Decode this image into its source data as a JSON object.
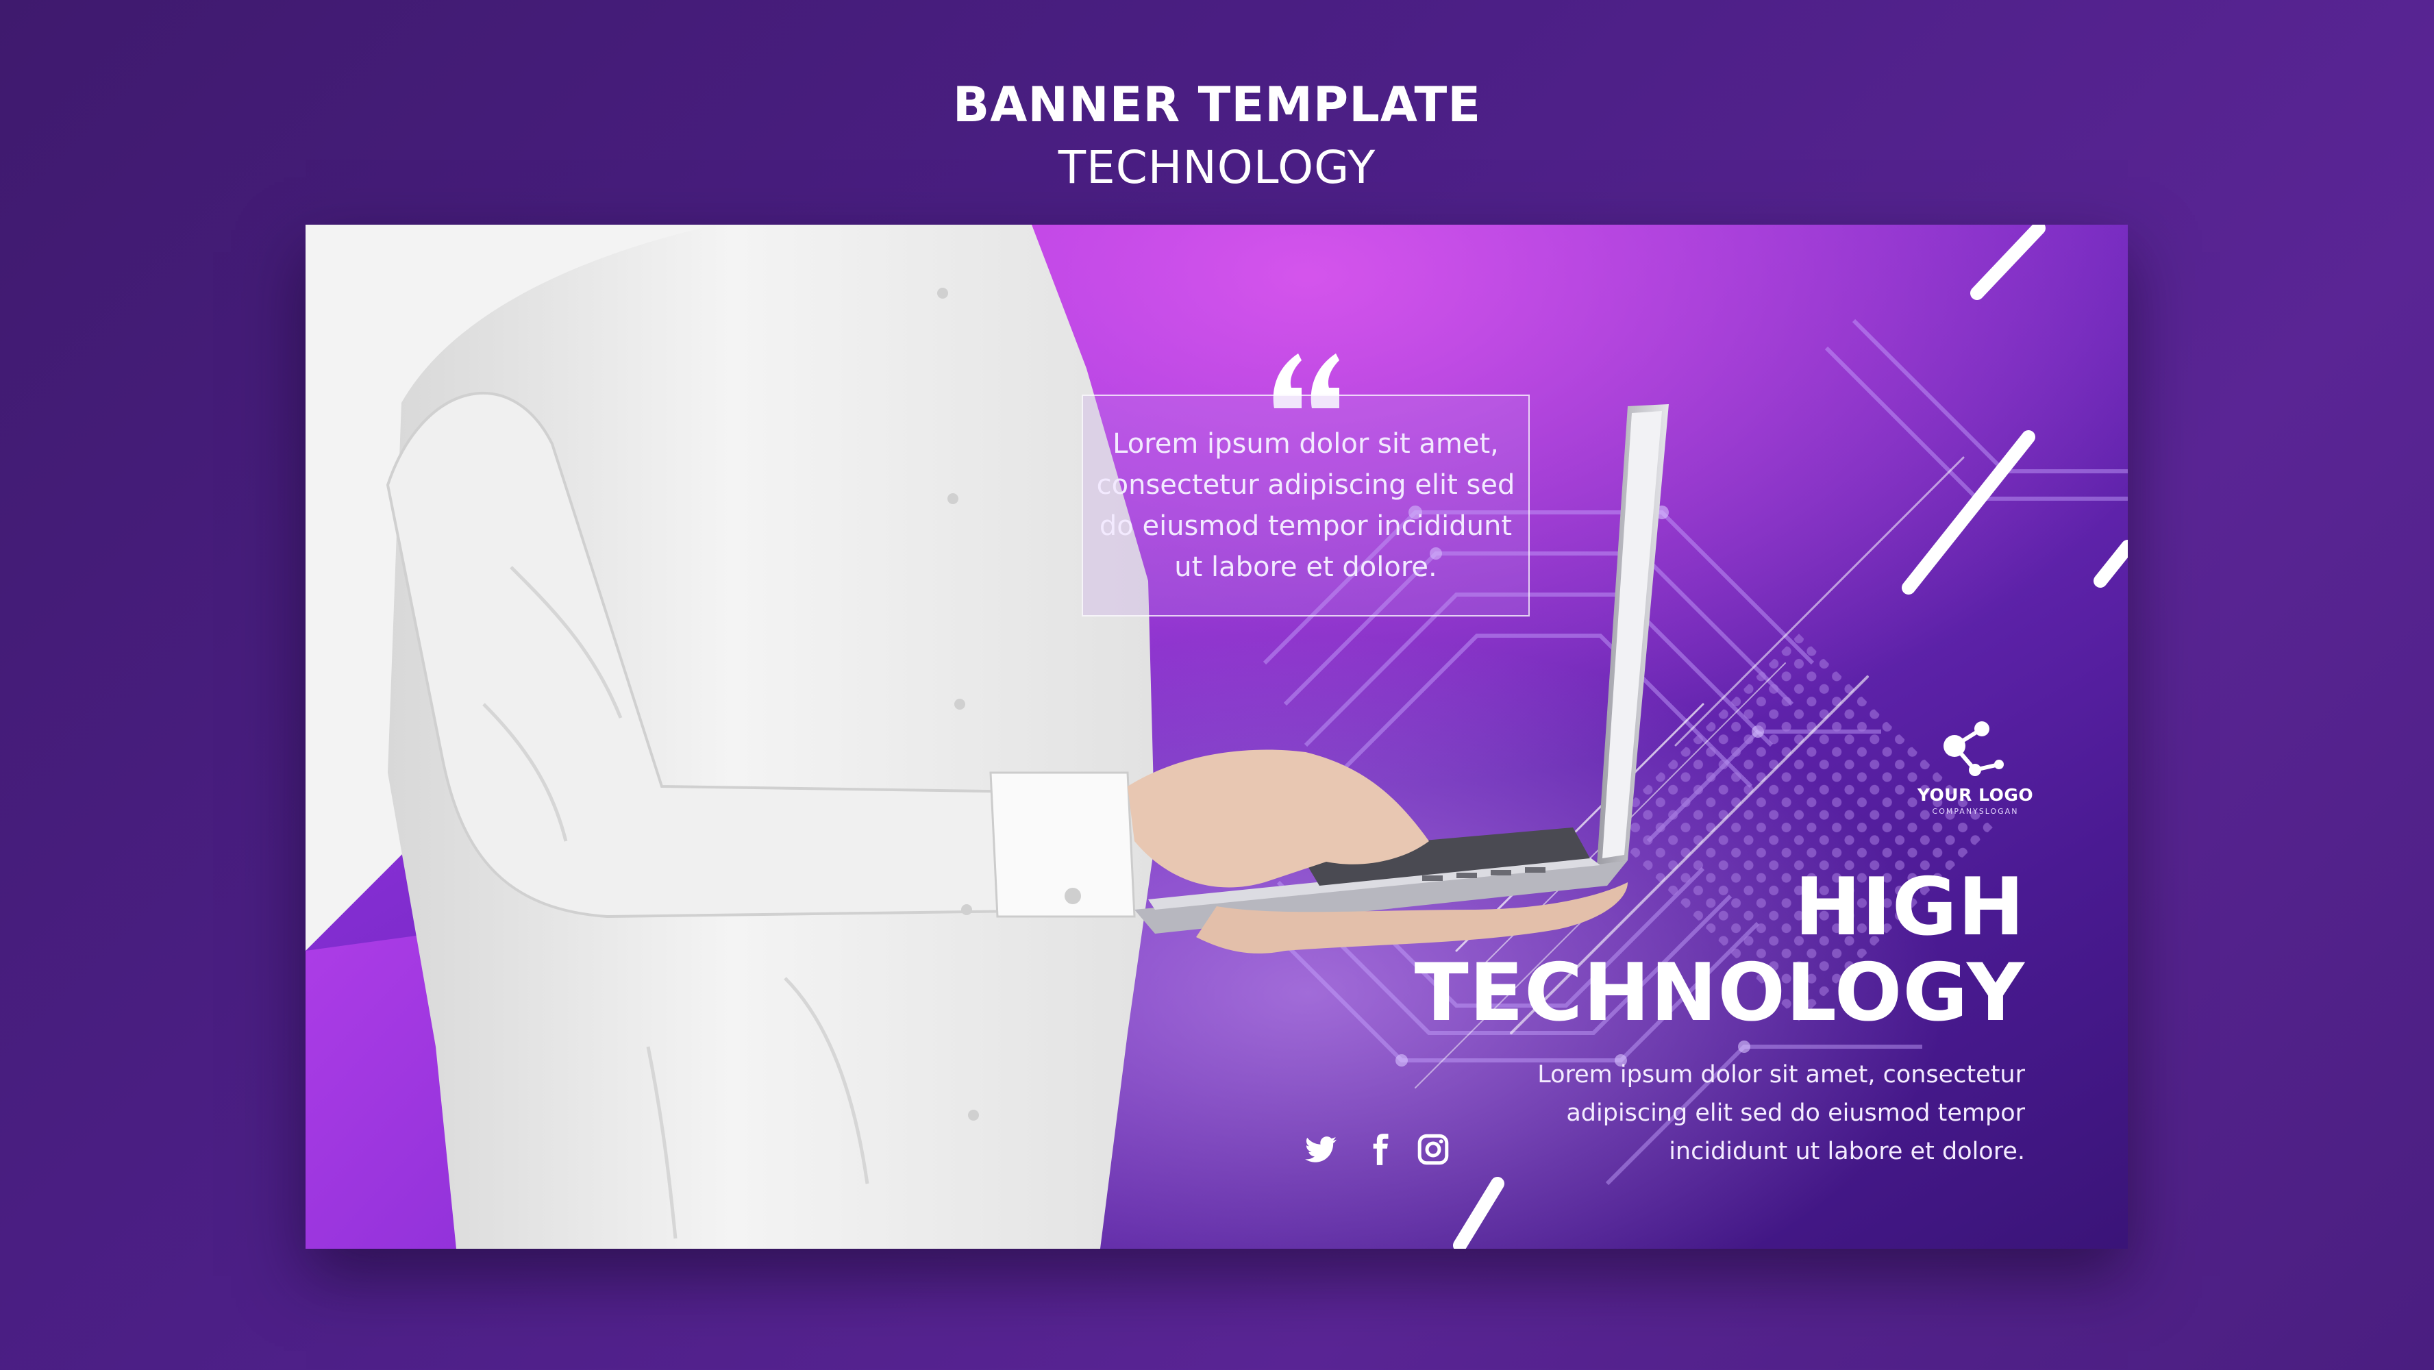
{
  "header": {
    "title": "BANNER TEMPLATE",
    "subtitle": "TECHNOLOGY"
  },
  "banner": {
    "quote": "Lorem ipsum dolor sit amet,\nconsectetur adipiscing elit sed\ndo eiusmod tempor incididunt\nut labore et dolore.",
    "logo": {
      "name": "YOUR LOGO",
      "slogan": "COMPANYSLOGAN",
      "icon": "molecule-icon"
    },
    "headline": {
      "line1": "HIGH",
      "line2": "TECHNOLOGY"
    },
    "body": "Lorem ipsum dolor sit amet, consectetur\nadipiscing elit sed do eiusmod tempor\nincididunt ut labore et dolore.",
    "social": [
      "twitter-icon",
      "facebook-icon",
      "instagram-icon"
    ]
  },
  "colors": {
    "page_background": "#4c1f86",
    "banner_accent": "#b93ae0",
    "banner_dark": "#3a1478",
    "text": "#ffffff"
  }
}
